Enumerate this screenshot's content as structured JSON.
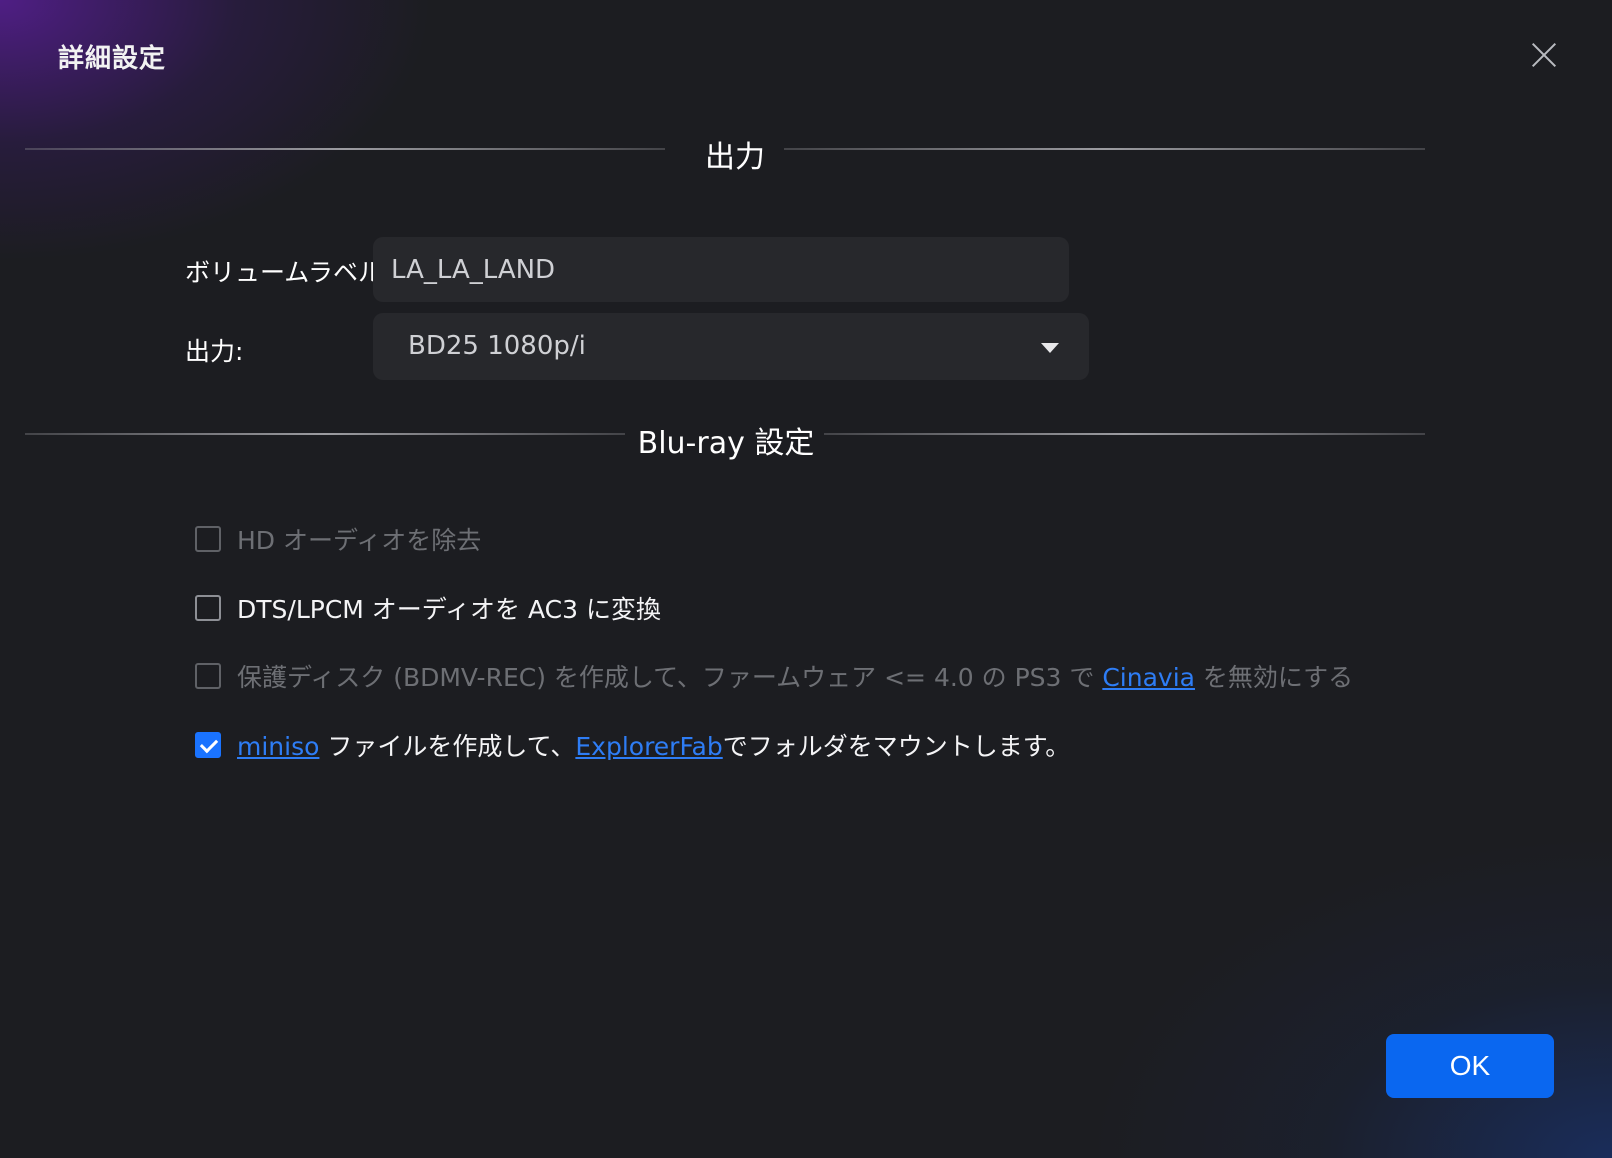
{
  "dialog": {
    "title": "詳細設定"
  },
  "sections": {
    "output": {
      "title": "出力"
    },
    "bluray": {
      "title": "Blu-ray 設定"
    }
  },
  "fields": {
    "volume_label": {
      "label": "ボリュームラベル:",
      "value": "LA_LA_LAND"
    },
    "output": {
      "label": "出力:",
      "selected": "BD25 1080p/i"
    }
  },
  "options": [
    {
      "checked": false,
      "disabled": true,
      "text": "HD オーディオを除去"
    },
    {
      "checked": false,
      "disabled": false,
      "text": "DTS/LPCM オーディオを AC3 に変換"
    },
    {
      "checked": false,
      "disabled": true,
      "text_before": "保護ディスク (BDMV-REC) を作成して、ファームウェア <= 4.0 の PS3 で ",
      "link": "Cinavia",
      "text_after": " を無効にする"
    },
    {
      "checked": true,
      "disabled": false,
      "link1": "miniso",
      "text_middle": " ファイルを作成して、",
      "link2": "ExplorerFab",
      "text_after": "でフォルダをマウントします。"
    }
  ],
  "buttons": {
    "ok": "OK"
  },
  "colors": {
    "accent": "#0a67f0",
    "link": "#2e7df5",
    "background": "#1c1d21",
    "input_background": "#27282c"
  },
  "icons": {
    "close": "close-icon",
    "dropdown": "chevron-down-icon",
    "checkmark": "check-icon"
  }
}
